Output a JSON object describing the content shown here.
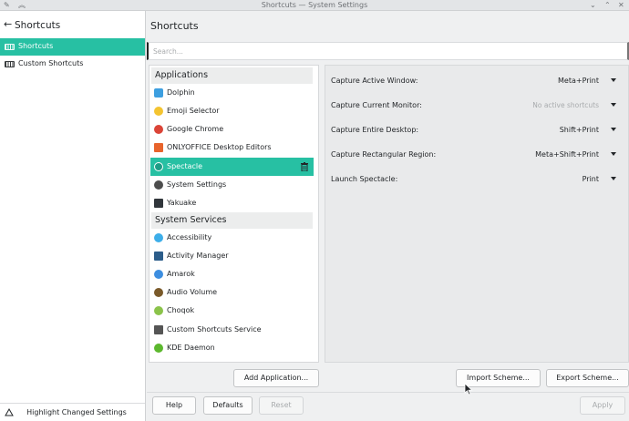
{
  "window": {
    "title": "Shortcuts — System Settings"
  },
  "sidebar": {
    "title": "Shortcuts",
    "items": [
      {
        "label": "Shortcuts"
      },
      {
        "label": "Custom Shortcuts"
      }
    ],
    "footer_label": "Highlight Changed Settings"
  },
  "main": {
    "title": "Shortcuts",
    "search_placeholder": "Search..."
  },
  "applications": {
    "header": "Applications",
    "items": [
      {
        "label": "Dolphin",
        "icon": "dolphin-icon",
        "color": "#3d9fe0"
      },
      {
        "label": "Emoji Selector",
        "icon": "emoji-icon",
        "color": "#f4c430"
      },
      {
        "label": "Google Chrome",
        "icon": "chrome-icon",
        "color": "#db4437"
      },
      {
        "label": "ONLYOFFICE Desktop Editors",
        "icon": "onlyoffice-icon",
        "color": "#e8642c"
      },
      {
        "label": "Spectacle",
        "icon": "spectacle-icon",
        "color": "#1e9c86"
      },
      {
        "label": "System Settings",
        "icon": "system-settings-icon",
        "color": "#4d4d4d"
      },
      {
        "label": "Yakuake",
        "icon": "yakuake-icon",
        "color": "#31363b"
      }
    ]
  },
  "system_services": {
    "header": "System Services",
    "items": [
      {
        "label": "Accessibility",
        "icon": "accessibility-icon",
        "color": "#3daee9"
      },
      {
        "label": "Activity Manager",
        "icon": "activity-manager-icon",
        "color": "#2c5d8a"
      },
      {
        "label": "Amarok",
        "icon": "amarok-icon",
        "color": "#3d8ee0"
      },
      {
        "label": "Audio Volume",
        "icon": "audio-volume-icon",
        "color": "#7a5a2a"
      },
      {
        "label": "Choqok",
        "icon": "choqok-icon",
        "color": "#8bc34a"
      },
      {
        "label": "Custom Shortcuts Service",
        "icon": "keyboard-icon",
        "color": "#555555"
      },
      {
        "label": "KDE Daemon",
        "icon": "kde-daemon-icon",
        "color": "#5cb82e"
      }
    ]
  },
  "shortcuts": [
    {
      "label": "Capture Active Window:",
      "value": "Meta+Print",
      "muted": false
    },
    {
      "label": "Capture Current Monitor:",
      "value": "No active shortcuts",
      "muted": true
    },
    {
      "label": "Capture Entire Desktop:",
      "value": "Shift+Print",
      "muted": false
    },
    {
      "label": "Capture Rectangular Region:",
      "value": "Meta+Shift+Print",
      "muted": false
    },
    {
      "label": "Launch Spectacle:",
      "value": "Print",
      "muted": false
    }
  ],
  "buttons": {
    "add_application": "Add Application...",
    "import_scheme": "Import Scheme...",
    "export_scheme": "Export Scheme...",
    "help": "Help",
    "defaults": "Defaults",
    "reset": "Reset",
    "apply": "Apply"
  },
  "colors": {
    "accent": "#27c0a3"
  }
}
